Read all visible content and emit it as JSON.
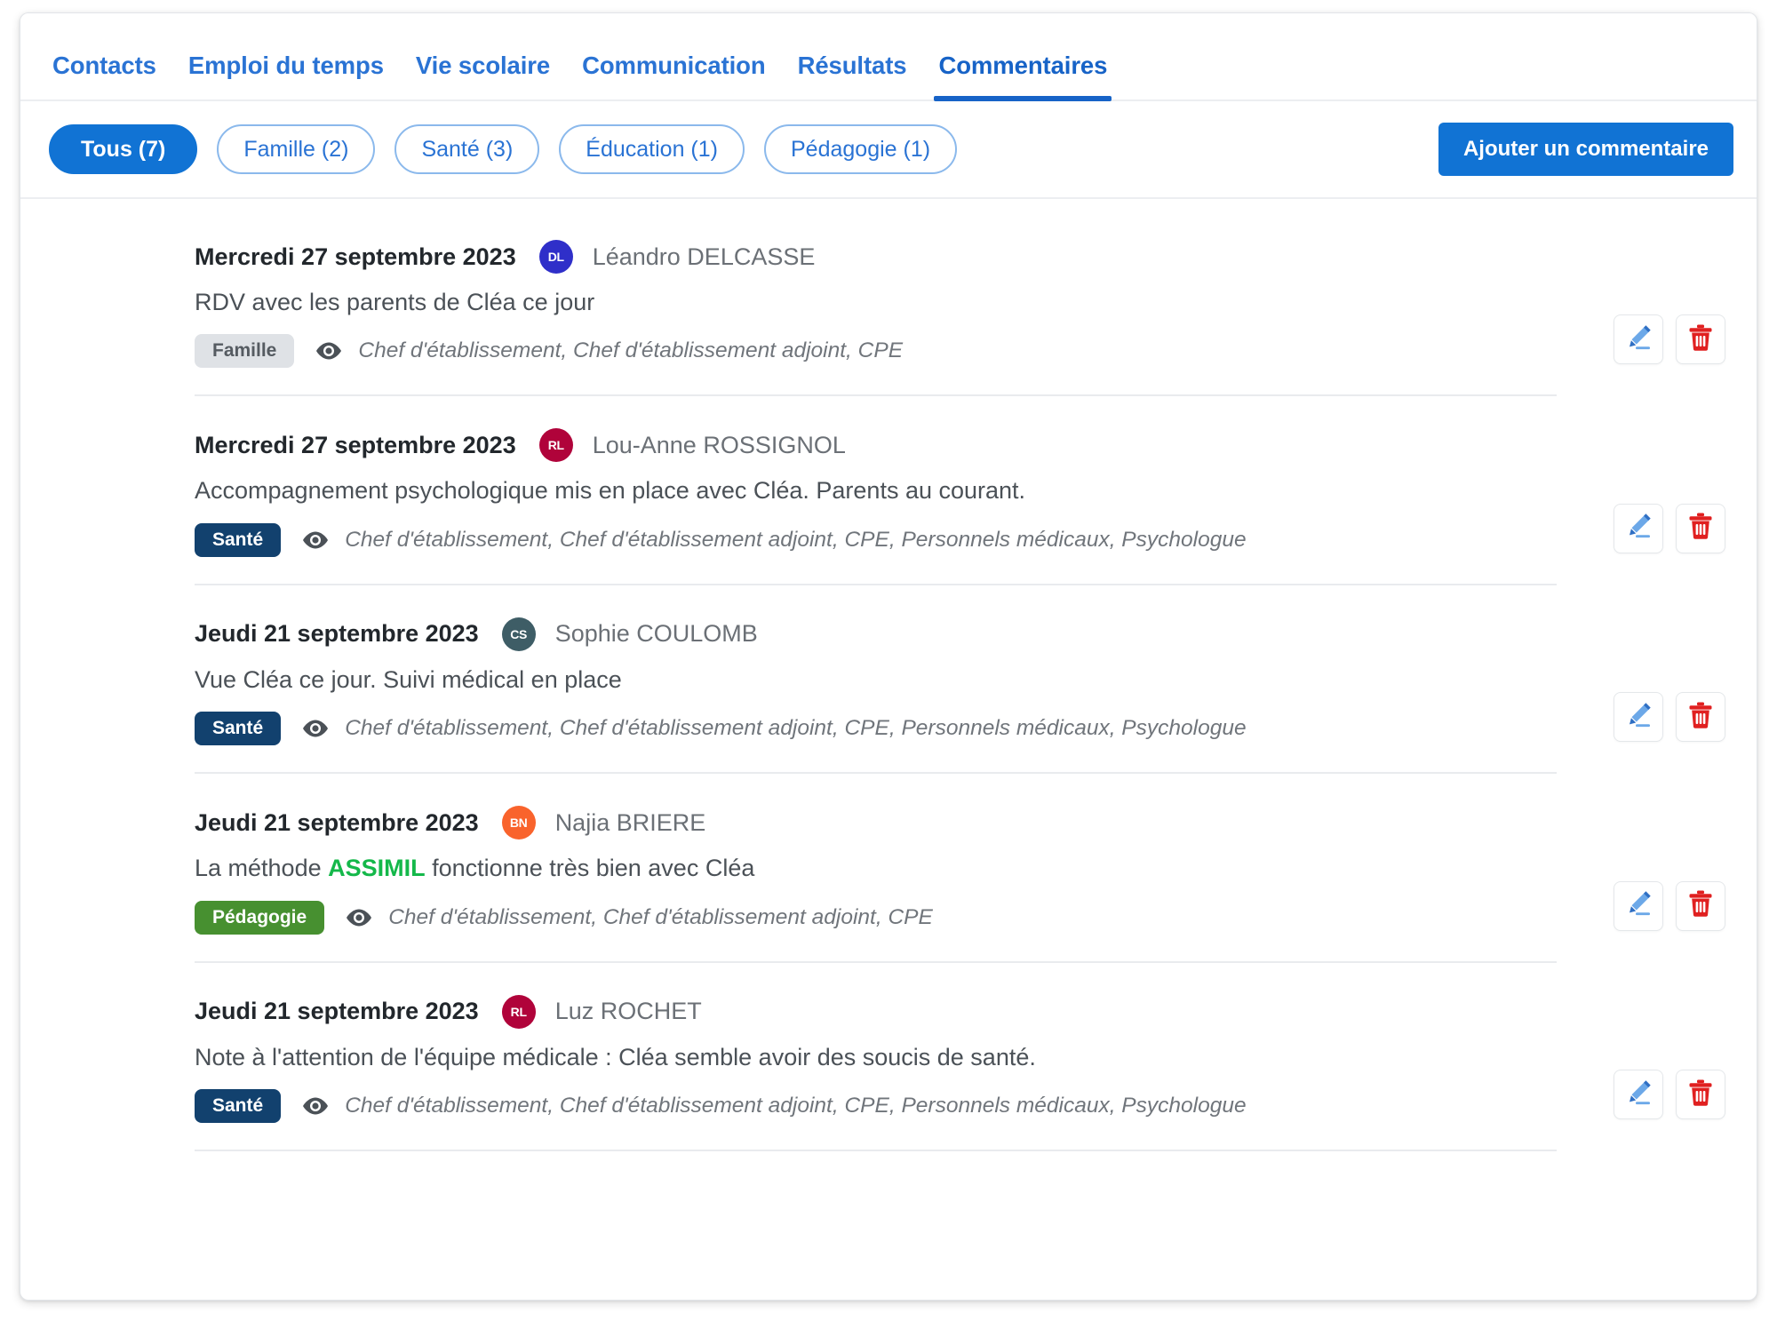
{
  "nav": {
    "tabs": [
      {
        "label": "Contacts",
        "active": false
      },
      {
        "label": "Emploi du temps",
        "active": false
      },
      {
        "label": "Vie scolaire",
        "active": false
      },
      {
        "label": "Communication",
        "active": false
      },
      {
        "label": "Résultats",
        "active": false
      },
      {
        "label": "Commentaires",
        "active": true
      }
    ]
  },
  "filters": {
    "chips": [
      {
        "label": "Tous (7)",
        "selected": true
      },
      {
        "label": "Famille (2)",
        "selected": false
      },
      {
        "label": "Santé (3)",
        "selected": false
      },
      {
        "label": "Éducation (1)",
        "selected": false
      },
      {
        "label": "Pédagogie (1)",
        "selected": false
      }
    ],
    "add_button": "Ajouter un commentaire"
  },
  "colors": {
    "accent": "#1173d4",
    "nav_link": "#2a73d4",
    "badge_sante": "#12416e",
    "badge_pedagogie": "#479030",
    "badge_famille_bg": "#dfe2e6",
    "highlight_green": "#14b84a",
    "delete_red": "#e02020",
    "edit_blue": "#3a7fd5"
  },
  "comments": [
    {
      "date": "Mercredi 27 septembre 2023",
      "author": "Léandro DELCASSE",
      "initials": "DL",
      "avatar_color": "#2f2fc9",
      "body": "RDV avec les parents de Cléa ce jour",
      "body_highlight": "",
      "category": "Famille",
      "category_class": "famille",
      "shared_with": "Chef d'établissement, Chef d'établissement adjoint, CPE"
    },
    {
      "date": "Mercredi 27 septembre 2023",
      "author": "Lou-Anne ROSSIGNOL",
      "initials": "RL",
      "avatar_color": "#b0033a",
      "body": "Accompagnement psychologique mis en place avec Cléa. Parents au courant.",
      "body_highlight": "",
      "category": "Santé",
      "category_class": "sante",
      "shared_with": "Chef d'établissement, Chef d'établissement adjoint, CPE, Personnels médicaux, Psychologue"
    },
    {
      "date": "Jeudi 21 septembre 2023",
      "author": "Sophie COULOMB",
      "initials": "CS",
      "avatar_color": "#3e5d66",
      "body": "Vue Cléa ce jour. Suivi médical en place",
      "body_highlight": "",
      "category": "Santé",
      "category_class": "sante",
      "shared_with": "Chef d'établissement, Chef d'établissement adjoint, CPE, Personnels médicaux, Psychologue"
    },
    {
      "date": "Jeudi 21 septembre 2023",
      "author": "Najia BRIERE",
      "initials": "BN",
      "avatar_color": "#f9632c",
      "body_before": "La méthode ",
      "body_highlight": "ASSIMIL",
      "body_after": " fonctionne très bien avec Cléa",
      "body": "La méthode ASSIMIL fonctionne très bien avec Cléa",
      "category": "Pédagogie",
      "category_class": "pedagogie",
      "shared_with": "Chef d'établissement, Chef d'établissement adjoint, CPE"
    },
    {
      "date": "Jeudi 21 septembre 2023",
      "author": "Luz ROCHET",
      "initials": "RL",
      "avatar_color": "#b0033a",
      "body": "Note à l'attention de l'équipe médicale : Cléa semble avoir des soucis de santé.",
      "body_highlight": "",
      "category": "Santé",
      "category_class": "sante",
      "shared_with": "Chef d'établissement, Chef d'établissement adjoint, CPE, Personnels médicaux, Psychologue"
    }
  ],
  "row_actions": {
    "edit_label": "Modifier",
    "delete_label": "Supprimer"
  }
}
